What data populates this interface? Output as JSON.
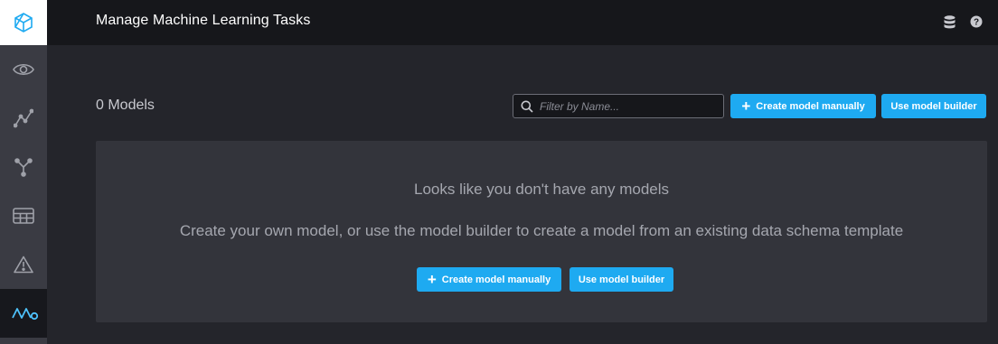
{
  "header": {
    "title": "Manage Machine Learning Tasks",
    "icons": [
      "database-icon",
      "help-icon"
    ]
  },
  "sidebar": {
    "items": [
      {
        "name": "logo",
        "icon": "logo-icon"
      },
      {
        "name": "overview",
        "icon": "eye-icon"
      },
      {
        "name": "analyze",
        "icon": "graph-icon"
      },
      {
        "name": "workflow",
        "icon": "branch-icon"
      },
      {
        "name": "tables",
        "icon": "table-icon"
      },
      {
        "name": "alerts",
        "icon": "warning-icon"
      },
      {
        "name": "machine-learning",
        "icon": "ml-icon",
        "active": true
      }
    ]
  },
  "toolbar": {
    "models_count": "0 Models",
    "filter_placeholder": "Filter by Name...",
    "create_manual_label": "Create model manually",
    "model_builder_label": "Use model builder"
  },
  "empty_state": {
    "title": "Looks like you don't have any models",
    "subtitle": "Create your own model, or use the model builder to create a model from an existing data schema template",
    "create_manual_label": "Create model manually",
    "model_builder_label": "Use model builder"
  },
  "colors": {
    "accent": "#1eaaf1",
    "header_bg": "#16171b",
    "content_bg": "#24252b",
    "panel_bg": "#33343b",
    "sidebar_bg": "#3a3b43"
  }
}
